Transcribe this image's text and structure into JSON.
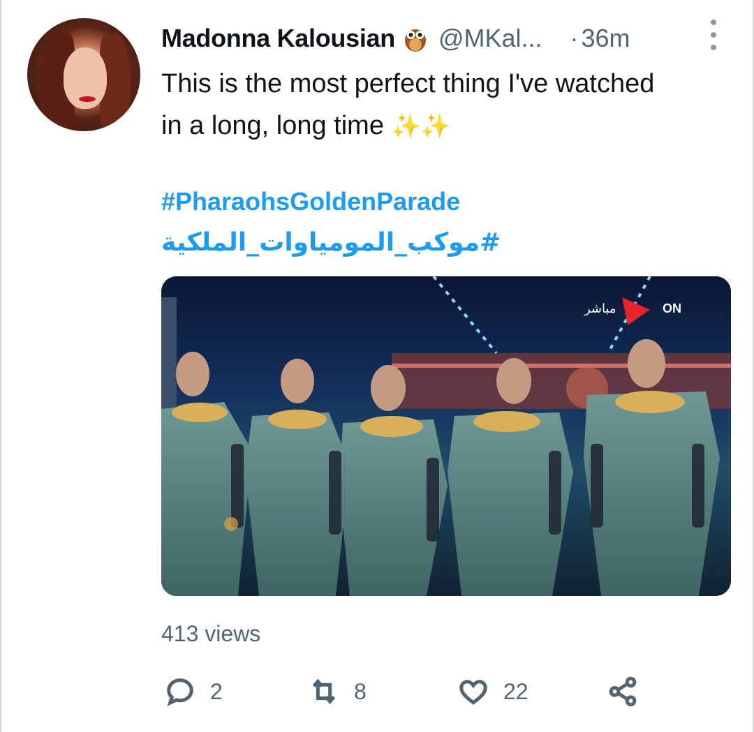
{
  "tweet": {
    "author_name": "Madonna Kalousian",
    "author_emoji": "🦉",
    "handle": "@MKal...",
    "separator": "·",
    "timestamp": "36m",
    "text_line1": "This is the most perfect thing I've watched",
    "text_line2": "in a long, long time",
    "sparkles": "✨✨",
    "hashtag_en": "#PharaohsGoldenParade",
    "hashtag_ar": "#موكب_المومياوات_الملكية",
    "media": {
      "live_badge": "مباشر",
      "channel_logo": "ON"
    },
    "views": "413 views",
    "actions": {
      "replies": "2",
      "retweets": "8",
      "likes": "22"
    }
  },
  "colors": {
    "link": "#1d9bf0",
    "secondary_text": "#536471",
    "primary_text": "#0f1419"
  }
}
